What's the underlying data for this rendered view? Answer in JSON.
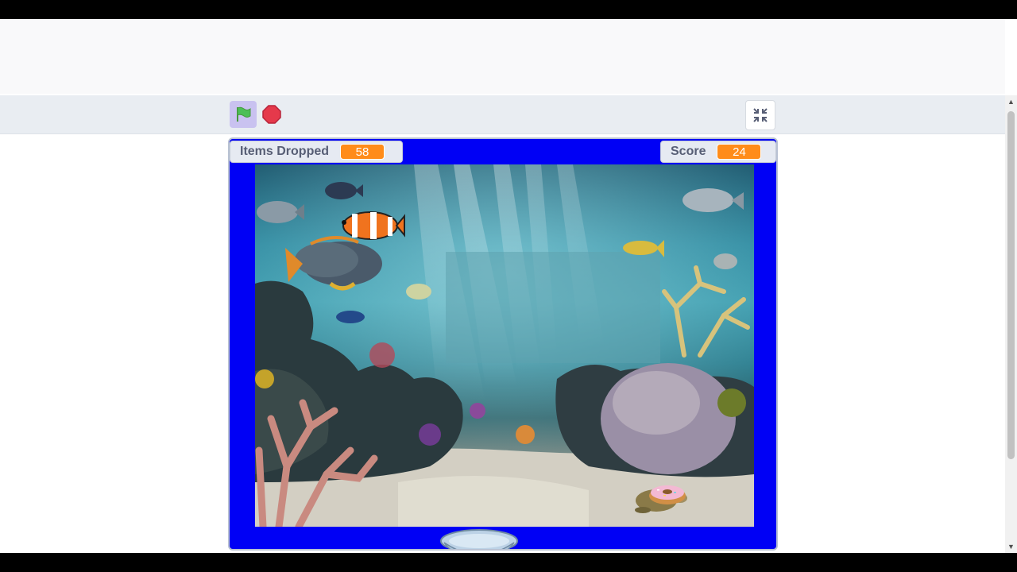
{
  "controls": {
    "green_flag_icon": "green-flag-icon",
    "stop_icon": "stop-sign-icon",
    "fullscreen_icon": "exit-fullscreen-icon"
  },
  "monitors": {
    "items_dropped": {
      "label": "Items Dropped",
      "value": "58"
    },
    "score": {
      "label": "Score",
      "value": "24"
    }
  },
  "colors": {
    "stage_border_fill": "#0000f5",
    "monitor_value_bg": "#ff8c1a",
    "green_flag_bg": "#c9c2f0",
    "stop_red": "#e5394b"
  }
}
